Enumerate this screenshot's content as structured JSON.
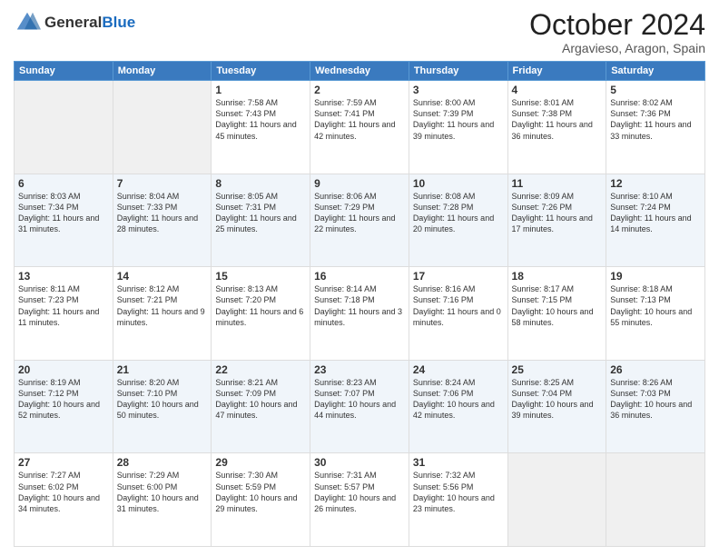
{
  "header": {
    "logo": {
      "general": "General",
      "blue": "Blue"
    },
    "title": "October 2024",
    "location": "Argavieso, Aragon, Spain"
  },
  "weekdays": [
    "Sunday",
    "Monday",
    "Tuesday",
    "Wednesday",
    "Thursday",
    "Friday",
    "Saturday"
  ],
  "weeks": [
    [
      {
        "day": "",
        "empty": true
      },
      {
        "day": "",
        "empty": true
      },
      {
        "day": "1",
        "sunrise": "Sunrise: 7:58 AM",
        "sunset": "Sunset: 7:43 PM",
        "daylight": "Daylight: 11 hours and 45 minutes."
      },
      {
        "day": "2",
        "sunrise": "Sunrise: 7:59 AM",
        "sunset": "Sunset: 7:41 PM",
        "daylight": "Daylight: 11 hours and 42 minutes."
      },
      {
        "day": "3",
        "sunrise": "Sunrise: 8:00 AM",
        "sunset": "Sunset: 7:39 PM",
        "daylight": "Daylight: 11 hours and 39 minutes."
      },
      {
        "day": "4",
        "sunrise": "Sunrise: 8:01 AM",
        "sunset": "Sunset: 7:38 PM",
        "daylight": "Daylight: 11 hours and 36 minutes."
      },
      {
        "day": "5",
        "sunrise": "Sunrise: 8:02 AM",
        "sunset": "Sunset: 7:36 PM",
        "daylight": "Daylight: 11 hours and 33 minutes."
      }
    ],
    [
      {
        "day": "6",
        "sunrise": "Sunrise: 8:03 AM",
        "sunset": "Sunset: 7:34 PM",
        "daylight": "Daylight: 11 hours and 31 minutes."
      },
      {
        "day": "7",
        "sunrise": "Sunrise: 8:04 AM",
        "sunset": "Sunset: 7:33 PM",
        "daylight": "Daylight: 11 hours and 28 minutes."
      },
      {
        "day": "8",
        "sunrise": "Sunrise: 8:05 AM",
        "sunset": "Sunset: 7:31 PM",
        "daylight": "Daylight: 11 hours and 25 minutes."
      },
      {
        "day": "9",
        "sunrise": "Sunrise: 8:06 AM",
        "sunset": "Sunset: 7:29 PM",
        "daylight": "Daylight: 11 hours and 22 minutes."
      },
      {
        "day": "10",
        "sunrise": "Sunrise: 8:08 AM",
        "sunset": "Sunset: 7:28 PM",
        "daylight": "Daylight: 11 hours and 20 minutes."
      },
      {
        "day": "11",
        "sunrise": "Sunrise: 8:09 AM",
        "sunset": "Sunset: 7:26 PM",
        "daylight": "Daylight: 11 hours and 17 minutes."
      },
      {
        "day": "12",
        "sunrise": "Sunrise: 8:10 AM",
        "sunset": "Sunset: 7:24 PM",
        "daylight": "Daylight: 11 hours and 14 minutes."
      }
    ],
    [
      {
        "day": "13",
        "sunrise": "Sunrise: 8:11 AM",
        "sunset": "Sunset: 7:23 PM",
        "daylight": "Daylight: 11 hours and 11 minutes."
      },
      {
        "day": "14",
        "sunrise": "Sunrise: 8:12 AM",
        "sunset": "Sunset: 7:21 PM",
        "daylight": "Daylight: 11 hours and 9 minutes."
      },
      {
        "day": "15",
        "sunrise": "Sunrise: 8:13 AM",
        "sunset": "Sunset: 7:20 PM",
        "daylight": "Daylight: 11 hours and 6 minutes."
      },
      {
        "day": "16",
        "sunrise": "Sunrise: 8:14 AM",
        "sunset": "Sunset: 7:18 PM",
        "daylight": "Daylight: 11 hours and 3 minutes."
      },
      {
        "day": "17",
        "sunrise": "Sunrise: 8:16 AM",
        "sunset": "Sunset: 7:16 PM",
        "daylight": "Daylight: 11 hours and 0 minutes."
      },
      {
        "day": "18",
        "sunrise": "Sunrise: 8:17 AM",
        "sunset": "Sunset: 7:15 PM",
        "daylight": "Daylight: 10 hours and 58 minutes."
      },
      {
        "day": "19",
        "sunrise": "Sunrise: 8:18 AM",
        "sunset": "Sunset: 7:13 PM",
        "daylight": "Daylight: 10 hours and 55 minutes."
      }
    ],
    [
      {
        "day": "20",
        "sunrise": "Sunrise: 8:19 AM",
        "sunset": "Sunset: 7:12 PM",
        "daylight": "Daylight: 10 hours and 52 minutes."
      },
      {
        "day": "21",
        "sunrise": "Sunrise: 8:20 AM",
        "sunset": "Sunset: 7:10 PM",
        "daylight": "Daylight: 10 hours and 50 minutes."
      },
      {
        "day": "22",
        "sunrise": "Sunrise: 8:21 AM",
        "sunset": "Sunset: 7:09 PM",
        "daylight": "Daylight: 10 hours and 47 minutes."
      },
      {
        "day": "23",
        "sunrise": "Sunrise: 8:23 AM",
        "sunset": "Sunset: 7:07 PM",
        "daylight": "Daylight: 10 hours and 44 minutes."
      },
      {
        "day": "24",
        "sunrise": "Sunrise: 8:24 AM",
        "sunset": "Sunset: 7:06 PM",
        "daylight": "Daylight: 10 hours and 42 minutes."
      },
      {
        "day": "25",
        "sunrise": "Sunrise: 8:25 AM",
        "sunset": "Sunset: 7:04 PM",
        "daylight": "Daylight: 10 hours and 39 minutes."
      },
      {
        "day": "26",
        "sunrise": "Sunrise: 8:26 AM",
        "sunset": "Sunset: 7:03 PM",
        "daylight": "Daylight: 10 hours and 36 minutes."
      }
    ],
    [
      {
        "day": "27",
        "sunrise": "Sunrise: 7:27 AM",
        "sunset": "Sunset: 6:02 PM",
        "daylight": "Daylight: 10 hours and 34 minutes."
      },
      {
        "day": "28",
        "sunrise": "Sunrise: 7:29 AM",
        "sunset": "Sunset: 6:00 PM",
        "daylight": "Daylight: 10 hours and 31 minutes."
      },
      {
        "day": "29",
        "sunrise": "Sunrise: 7:30 AM",
        "sunset": "Sunset: 5:59 PM",
        "daylight": "Daylight: 10 hours and 29 minutes."
      },
      {
        "day": "30",
        "sunrise": "Sunrise: 7:31 AM",
        "sunset": "Sunset: 5:57 PM",
        "daylight": "Daylight: 10 hours and 26 minutes."
      },
      {
        "day": "31",
        "sunrise": "Sunrise: 7:32 AM",
        "sunset": "Sunset: 5:56 PM",
        "daylight": "Daylight: 10 hours and 23 minutes."
      },
      {
        "day": "",
        "empty": true
      },
      {
        "day": "",
        "empty": true
      }
    ]
  ]
}
